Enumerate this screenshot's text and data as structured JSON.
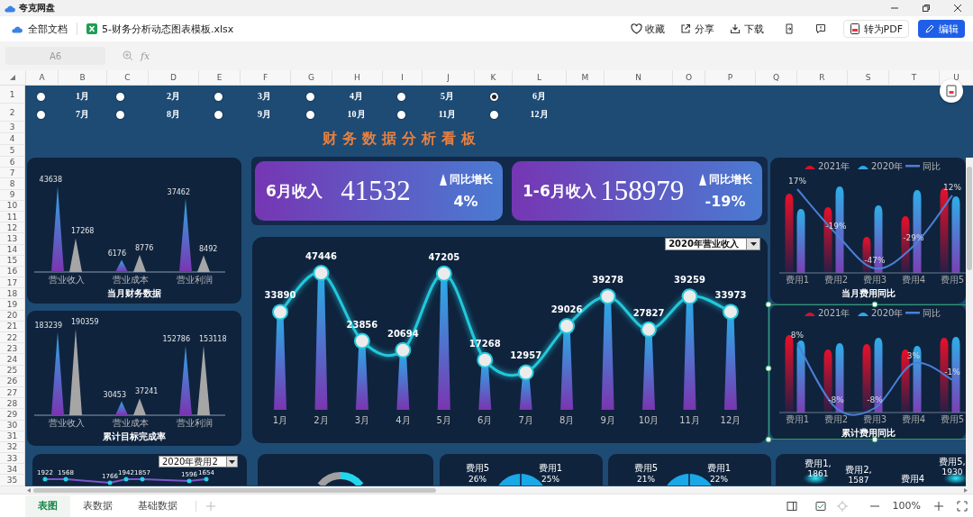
{
  "app": {
    "title": "夸克网盘"
  },
  "toolbar": {
    "breadcrumb": "全部文档",
    "file_name": "5-财务分析动态图表模板.xlsx",
    "actions": [
      {
        "kind": "plain",
        "label": "收藏"
      },
      {
        "kind": "plain",
        "label": "分享"
      },
      {
        "kind": "plain",
        "label": "下载"
      },
      {
        "kind": "icon"
      },
      {
        "kind": "icon"
      },
      {
        "kind": "outline",
        "label": "转为PDF"
      },
      {
        "kind": "primary",
        "label": "编辑"
      }
    ]
  },
  "formula_bar": {
    "cell_ref": "A6",
    "function_label": "fx"
  },
  "grid": {
    "columns": [
      "A",
      "B",
      "C",
      "D",
      "E",
      "F",
      "G",
      "H",
      "I",
      "J",
      "K",
      "L",
      "M",
      "N",
      "O",
      "P",
      "Q",
      "R",
      "S",
      "T",
      "U"
    ],
    "rows": [
      "1",
      "2",
      "3",
      "4",
      "5",
      "6",
      "7",
      "8",
      "9",
      "10",
      "11",
      "12",
      "13",
      "14",
      "15",
      "16",
      "17",
      "18",
      "19",
      "20",
      "21",
      "22",
      "23",
      "24",
      "25",
      "26",
      "27",
      "28",
      "29",
      "30",
      "31",
      "32",
      "33",
      "34",
      "35"
    ]
  },
  "month_selector": {
    "options": [
      {
        "label": "1月",
        "selected": false
      },
      {
        "label": "2月",
        "selected": false
      },
      {
        "label": "3月",
        "selected": false
      },
      {
        "label": "4月",
        "selected": false
      },
      {
        "label": "5月",
        "selected": false
      },
      {
        "label": "6月",
        "selected": true
      },
      {
        "label": "7月",
        "selected": false
      },
      {
        "label": "8月",
        "selected": false
      },
      {
        "label": "9月",
        "selected": false
      },
      {
        "label": "10月",
        "selected": false
      },
      {
        "label": "11月",
        "selected": false
      },
      {
        "label": "12月",
        "selected": false
      }
    ]
  },
  "dashboard_title": "财务数据分析看板",
  "kpis": [
    {
      "label": "6月收入",
      "value": "41532",
      "trend_label": "同比增长",
      "change": "4%"
    },
    {
      "label": "1-6月收入",
      "value": "158979",
      "trend_label": "同比增长",
      "change": "-19%"
    }
  ],
  "left_charts": [
    {
      "title": "当月财务数据",
      "groups": [
        {
          "category": "营业收入",
          "labels": [
            "43638",
            "17268"
          ]
        },
        {
          "category": "营业成本",
          "labels": [
            "6176",
            "8776"
          ]
        },
        {
          "category": "营业利润",
          "labels": [
            "37462",
            "8492"
          ]
        }
      ]
    },
    {
      "title": "累计目标完成率",
      "groups": [
        {
          "category": "营业收入",
          "labels": [
            "183239",
            "190359"
          ]
        },
        {
          "category": "营业成本",
          "labels": [
            "30453",
            "37241"
          ]
        },
        {
          "category": "营业利润",
          "labels": [
            "152786",
            "153118"
          ]
        }
      ]
    }
  ],
  "main_chart": {
    "dropdown": "2020年营业收入",
    "chart_data": {
      "type": "line",
      "categories": [
        "1月",
        "2月",
        "3月",
        "4月",
        "5月",
        "6月",
        "7月",
        "8月",
        "9月",
        "10月",
        "11月",
        "12月"
      ],
      "series": [
        {
          "color": "#22c8dc",
          "marker": "circle",
          "values": [
            33890,
            47446,
            23856,
            20694,
            47205,
            17268,
            12957,
            29026,
            39278,
            27827,
            39259,
            33973
          ]
        }
      ],
      "data_labels": true
    }
  },
  "right_charts": [
    {
      "title": "当月费用同比",
      "selected": false,
      "legend": [
        {
          "kind": "bar",
          "label": "2021年",
          "color": "#d8102a"
        },
        {
          "kind": "bar",
          "label": "2020年",
          "color": "#2ea8e6"
        },
        {
          "kind": "line",
          "label": "同比",
          "color": "#4a7fd6"
        }
      ],
      "categories": [
        "费用1",
        "费用2",
        "费用3",
        "费用4",
        "费用5"
      ],
      "line_labels": [
        "17%",
        "-19%",
        "-47%",
        "-29%",
        "12%"
      ]
    },
    {
      "title": "累计费用同比",
      "selected": true,
      "legend": [
        {
          "kind": "bar",
          "label": "2021年",
          "color": "#d8102a"
        },
        {
          "kind": "bar",
          "label": "2020年",
          "color": "#2ea8e6"
        },
        {
          "kind": "line",
          "label": "同比",
          "color": "#4a7fd6"
        }
      ],
      "categories": [
        "费用1",
        "费用2",
        "费用3",
        "费用4",
        "费用5"
      ],
      "line_labels": [
        "8%",
        "-8%",
        "-8%",
        "3%",
        "-1%"
      ]
    }
  ],
  "bottom_panels": [
    {
      "kind": "line",
      "dropdown": "2020年费用2",
      "point_labels": [
        "1922",
        "1568",
        "1766",
        "1942",
        "1857",
        "1596",
        "1654"
      ]
    },
    {
      "kind": "donut"
    },
    {
      "kind": "pie",
      "slices": [
        {
          "name": "费用5",
          "percent": "26%"
        },
        {
          "name": "费用1",
          "percent": "25%"
        }
      ]
    },
    {
      "kind": "pie",
      "slices": [
        {
          "name": "费用5",
          "percent": "21%"
        },
        {
          "name": "费用1",
          "percent": "22%"
        }
      ]
    },
    {
      "kind": "bubble",
      "labels": [
        {
          "name": "费用1,",
          "value": "1861"
        },
        {
          "name": "费用2,",
          "value": "1587"
        },
        {
          "name": "费用4"
        },
        {
          "name": "费用5,",
          "value": "1930"
        }
      ]
    }
  ],
  "sheet_tabs": [
    {
      "label": "表图",
      "selected": true
    },
    {
      "label": "表数据",
      "selected": false
    },
    {
      "label": "基础数据",
      "selected": false
    }
  ],
  "status_bar": {
    "zoom": "100%"
  }
}
